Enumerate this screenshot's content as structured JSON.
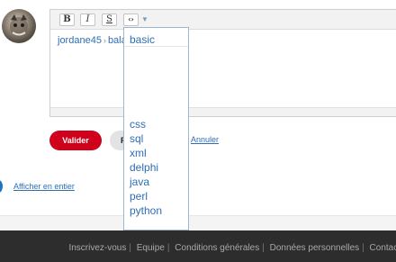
{
  "toolbar": {
    "bold_label": "B",
    "italic_label": "I",
    "underline_label": "S",
    "code_label": "‹›",
    "dropdown_caret": "▼"
  },
  "breadcrumb": {
    "user": "jordane45",
    "separator": "›",
    "partial": "bala"
  },
  "code_dropdown": {
    "selected": "basic",
    "options": [
      "css",
      "sql",
      "xml",
      "delphi",
      "java",
      "perl",
      "python"
    ]
  },
  "actions": {
    "submit_label": "Valider",
    "preview_label": "Prévisualiser",
    "cancel_label": "Annuler"
  },
  "expand_link": "Afficher en entier",
  "footer": {
    "links": [
      "Inscrivez-vous",
      "Equipe",
      "Conditions générales",
      "Données personnelles",
      "Contact"
    ]
  },
  "colors": {
    "accent_red": "#d0021b",
    "link_blue": "#2f6db5",
    "footer_bg": "#2d2d2d"
  }
}
